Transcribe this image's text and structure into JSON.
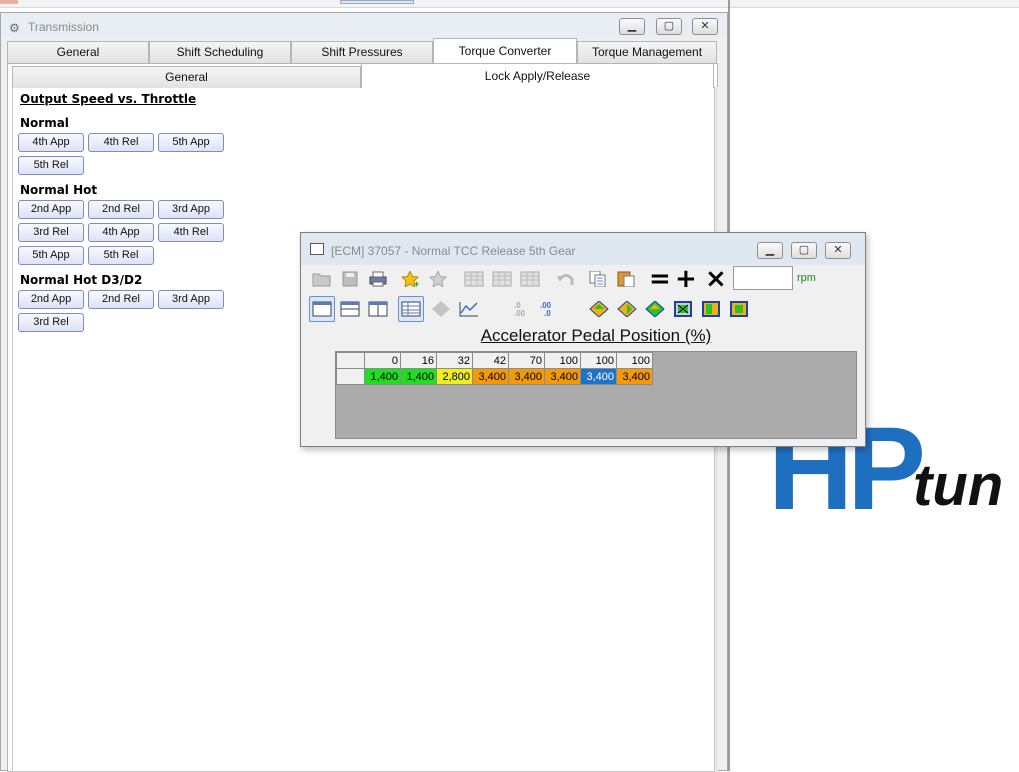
{
  "transmission_window": {
    "title": "Transmission",
    "tabs": [
      "General",
      "Shift Scheduling",
      "Shift Pressures",
      "Torque Converter",
      "Torque Management"
    ],
    "active_tab": "Torque Converter",
    "sub_tabs": [
      "General",
      "Lock Apply/Release"
    ],
    "active_sub_tab": "Lock Apply/Release",
    "section_heading": "Output Speed vs. Throttle",
    "groups": [
      {
        "title": "Normal",
        "buttons": [
          "4th App",
          "4th Rel",
          "5th App",
          "5th Rel"
        ]
      },
      {
        "title": "Normal Hot",
        "buttons": [
          "2nd App",
          "2nd Rel",
          "3rd App",
          "3rd Rel",
          "4th App",
          "4th Rel",
          "5th App",
          "5th Rel"
        ]
      },
      {
        "title": "Normal Hot D3/D2",
        "buttons": [
          "2nd App",
          "2nd Rel",
          "3rd App",
          "3rd Rel"
        ]
      }
    ]
  },
  "table_window": {
    "title": "[ECM] 37057 - Normal TCC Release 5th Gear",
    "rpm_unit": "rpm",
    "operators": [
      "=",
      "+",
      "×"
    ],
    "toolbar_icons": [
      "open-icon",
      "save-icon",
      "print-icon",
      "add-favorite-icon",
      "remove-favorite-icon",
      "table-icon",
      "table-icon",
      "table-icon",
      "undo-icon",
      "copy-icon",
      "paste-icon"
    ],
    "view_icons": [
      "layout-single-icon",
      "layout-horizontal-icon",
      "layout-vertical-icon",
      "table-view-icon",
      "3d-view-icon",
      "graph-view-icon",
      "decrease-decimals-icon",
      "increase-decimals-icon",
      "color-fill-icon",
      "color-fill-icon",
      "color-fill-icon",
      "select-icon",
      "select-icon",
      "select-icon"
    ],
    "axis_label": "Accelerator Pedal Position (%)",
    "columns": [
      "0",
      "16",
      "32",
      "42",
      "70",
      "100",
      "100",
      "100"
    ],
    "values": [
      "1,400",
      "1,400",
      "2,800",
      "3,400",
      "3,400",
      "3,400",
      "3,400",
      "3,400"
    ],
    "cell_colors": [
      "#22dd22",
      "#22dd22",
      "#eeee22",
      "#f39a0c",
      "#f39a0c",
      "#f39a0c",
      "#1e73c8",
      "#f39a0c"
    ]
  },
  "logo": {
    "hp": "HP",
    "tun": "tun"
  }
}
